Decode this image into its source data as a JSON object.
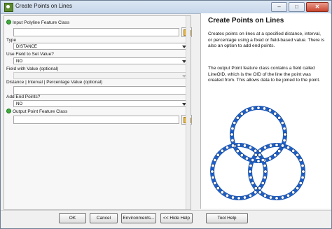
{
  "window": {
    "title": "Create Points on Lines",
    "minimize": "–",
    "maximize": "□",
    "close": "✕"
  },
  "form": {
    "input_label": "Input Polyline Feature Class",
    "input_value": "",
    "type_label": "Type",
    "type_value": "DISTANCE",
    "use_field_label": "Use Field to Set Value?",
    "use_field_value": "NO",
    "field_value_label": "Field with Value (optional)",
    "field_value_value": "",
    "interval_label": "Distance | Interval | Percentage Value (optional)",
    "interval_value": "",
    "add_end_label": "Add End Points?",
    "add_end_value": "NO",
    "output_label": "Output Point Feature Class",
    "output_value": ""
  },
  "help": {
    "title": "Create Points on Lines",
    "para1": "Creates points on lines at a specified distance, interval, or percentage using a fixed or field-based value. There is also an option to add end points.",
    "para2": "The output Point feature class contains a field called LineOID, which is the OID of the line the point was created from. This allows data to be joined to the point.",
    "diagram_colors": {
      "line": "#1f5fc4",
      "dot": "#ffffff"
    }
  },
  "buttons": {
    "ok": "OK",
    "cancel": "Cancel",
    "environments": "Environments...",
    "hide_help": "<< Hide Help",
    "tool_help": "Tool Help"
  }
}
